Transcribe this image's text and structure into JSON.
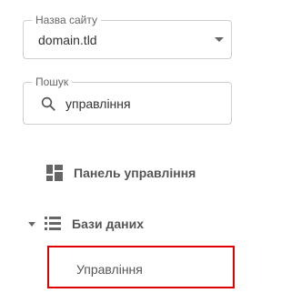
{
  "site_select": {
    "legend": "Назва сайту",
    "value": "domain.tld"
  },
  "search": {
    "legend": "Пошук",
    "value": "управління"
  },
  "nav": {
    "dashboard": {
      "label": "Панель управління",
      "icon": "dashboard-icon"
    },
    "databases": {
      "label": "Бази даних",
      "icon": "database-icon",
      "expanded": true,
      "items": [
        {
          "label": "Управління",
          "highlighted": true
        }
      ]
    }
  },
  "colors": {
    "highlight_border": "#e00000",
    "icon_gray": "#666666"
  }
}
